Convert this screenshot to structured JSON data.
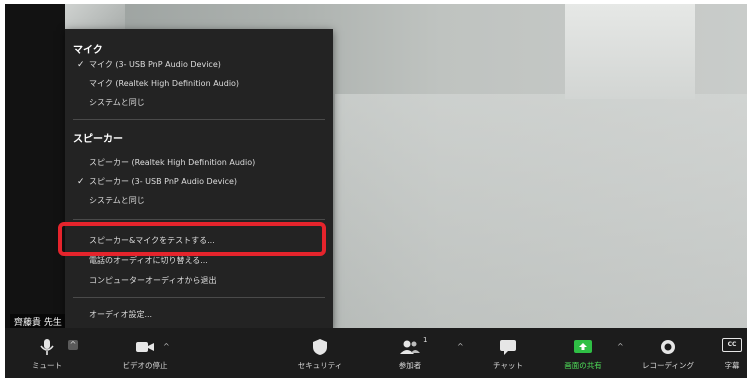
{
  "video": {
    "name_tag": "齊藤貴 先生"
  },
  "menu": {
    "mic_title": "マイク",
    "mic_items": [
      {
        "label": "マイク (3- USB PnP Audio Device)",
        "checked": true
      },
      {
        "label": "マイク (Realtek High Definition Audio)",
        "checked": false
      },
      {
        "label": "システムと同じ",
        "checked": false
      }
    ],
    "speaker_title": "スピーカー",
    "speaker_items": [
      {
        "label": "スピーカー (Realtek High Definition Audio)",
        "checked": false
      },
      {
        "label": "スピーカー (3- USB PnP Audio Device)",
        "checked": true
      },
      {
        "label": "システムと同じ",
        "checked": false
      }
    ],
    "test_item": "スピーカー&マイクをテストする...",
    "phone_item": "電話のオーディオに切り替える...",
    "leave_item": "コンピューターオーディオから退出",
    "settings_item": "オーディオ設定...",
    "check_glyph": "✓",
    "highlight_color": "#e5242c"
  },
  "toolbar": {
    "mute_label": "ミュート",
    "video_label": "ビデオの停止",
    "security_label": "セキュリティ",
    "participants_label": "参加者",
    "participants_count": "1",
    "chat_label": "チャット",
    "share_label": "画面の共有",
    "record_label": "レコーディング",
    "cc_label": "字幕",
    "cc_icon_text": "CC",
    "caret": "^",
    "share_color": "#4fe05a"
  }
}
